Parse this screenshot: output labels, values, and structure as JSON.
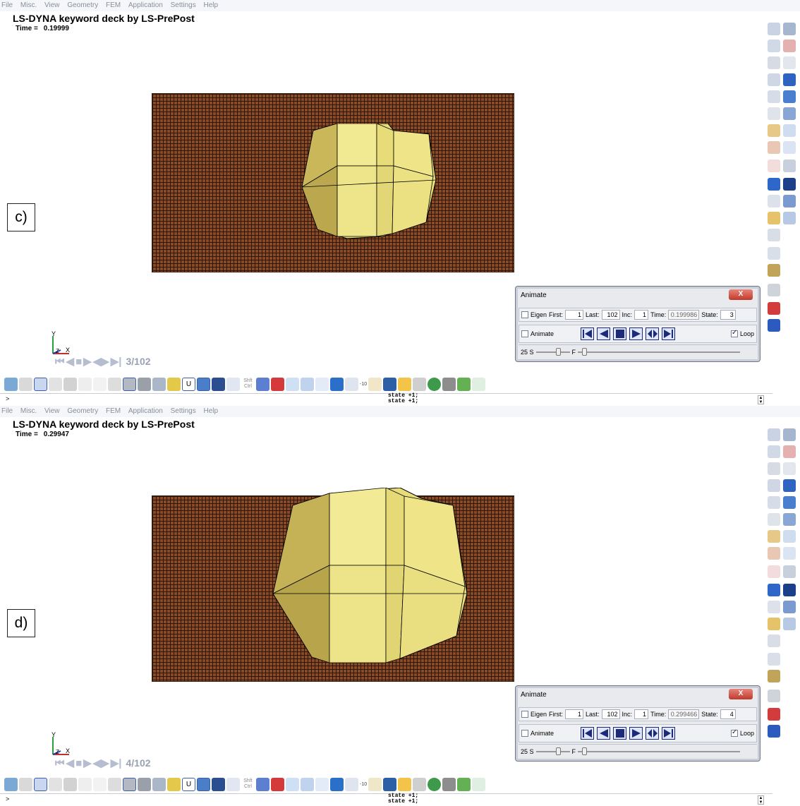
{
  "menu": [
    "File",
    "Misc.",
    "View",
    "Geometry",
    "FEM",
    "Application",
    "Settings",
    "Help"
  ],
  "panels": [
    {
      "label": "c)",
      "title": "LS-DYNA keyword deck by LS-PrePost",
      "time_label": "Time =",
      "time_value": "0.19999",
      "frame_counter": "3/102",
      "axis": {
        "y": "Y",
        "z": "Z",
        "x": "X"
      },
      "dialog": {
        "title": "Animate",
        "eigen_label": "Eigen",
        "first_label": "First:",
        "first_value": "1",
        "last_label": "Last:",
        "last_value": "102",
        "inc_label": "Inc:",
        "inc_value": "1",
        "time_label": "Time:",
        "time_value": "0.199986",
        "state_label": "State:",
        "state_value": "3",
        "animate_label": "Animate",
        "loop_label": "Loop",
        "speed_label": "25 S",
        "f_label": "F",
        "close_label": "X"
      },
      "log_lines": [
        "state +1;",
        "state +1;"
      ],
      "prompt": ">"
    },
    {
      "label": "d)",
      "title": "LS-DYNA keyword deck by LS-PrePost",
      "time_label": "Time =",
      "time_value": "0.29947",
      "frame_counter": "4/102",
      "axis": {
        "y": "Y",
        "z": "Z",
        "x": "X"
      },
      "dialog": {
        "title": "Animate",
        "eigen_label": "Eigen",
        "first_label": "First:",
        "first_value": "1",
        "last_label": "Last:",
        "last_value": "102",
        "inc_label": "Inc:",
        "inc_value": "1",
        "time_label": "Time:",
        "time_value": "0.299466",
        "state_label": "State:",
        "state_value": "4",
        "animate_label": "Animate",
        "loop_label": "Loop",
        "speed_label": "25 S",
        "f_label": "F",
        "close_label": "X"
      },
      "log_lines": [
        "state +1;",
        "state +1;"
      ],
      "prompt": ">"
    }
  ],
  "toolbar": {
    "shft_label": "Shft",
    "ctrl_label": "Ctrl",
    "zoom_value": "-10",
    "u_label": "U"
  },
  "colors": {
    "mesh": "#8b4a26",
    "part": "#e6dd7a",
    "accent": "#1d2a7a"
  }
}
